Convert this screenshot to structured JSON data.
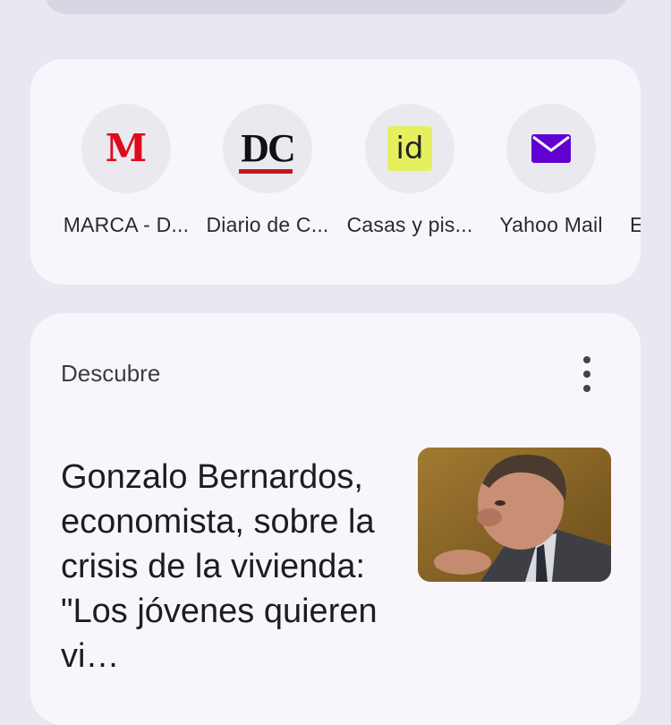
{
  "shortcuts": [
    {
      "logo_text": "M",
      "label": "MARCA - D...",
      "icon": "marca-logo-icon",
      "color": "#e00a1c"
    },
    {
      "logo_text": "DC",
      "label": "Diario de C...",
      "icon": "diario-de-cadiz-logo-icon",
      "color": "#111111"
    },
    {
      "logo_text": "id",
      "label": "Casas y pis...",
      "icon": "idealista-logo-icon",
      "color": "#e6f05f"
    },
    {
      "logo_text": "",
      "label": "Yahoo Mail",
      "icon": "mail-envelope-icon",
      "color": "#6001d2"
    },
    {
      "label": "E",
      "icon": "partial-shortcut"
    }
  ],
  "discover": {
    "title": "Descubre",
    "article": {
      "headline": "Gonzalo Bernardos, economista, sobre la crisis de la vivienda: \"Los jóvenes quieren vi…",
      "image": "news-photo-man-speaking"
    }
  }
}
